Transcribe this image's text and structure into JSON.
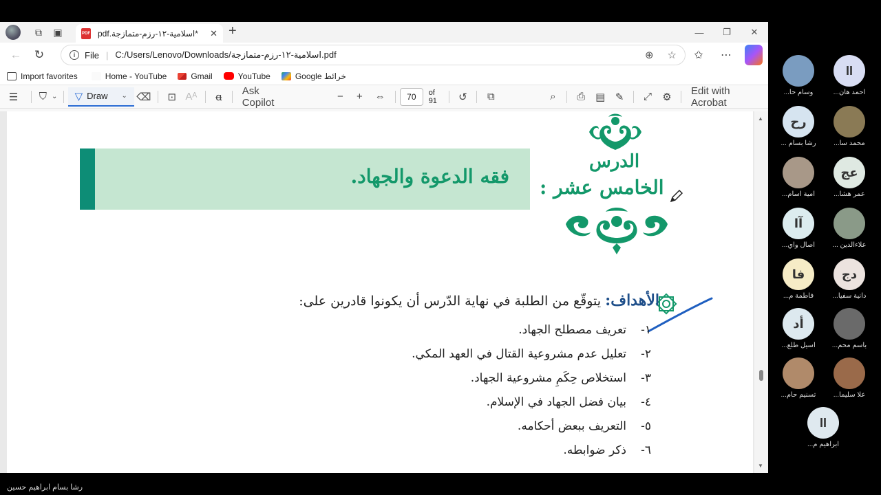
{
  "tab": {
    "title": "*اسلامية-١٢-رزم-متمازجة.pdf",
    "pdf_badge": "PDF"
  },
  "address": {
    "scheme_label": "File",
    "path": "C:/Users/Lenovo/Downloads/اسلامية-١٢-رزم-متمازجة.pdf"
  },
  "favorites": [
    {
      "label": "Import favorites"
    },
    {
      "label": "Home - YouTube"
    },
    {
      "label": "Gmail"
    },
    {
      "label": "YouTube"
    },
    {
      "label": "Google خرائط"
    }
  ],
  "pdf_toolbar": {
    "draw_label": "Draw",
    "ask_copilot": "Ask Copilot",
    "page_number": "70",
    "page_total": "of 91",
    "edit_acrobat": "Edit with Acrobat"
  },
  "document": {
    "lesson_word": "الدرس",
    "lesson_number": "الخامس عشر :",
    "banner_title": "فقه الدعوة والجهاد.",
    "goals_label": "الأهداف:",
    "goals_intro": "يتوقّع من الطلبة في نهاية الدّرس أن يكونوا قادرين على:",
    "goals": [
      {
        "num": "١-",
        "text": "تعريف مصطلح الجهاد."
      },
      {
        "num": "٢-",
        "text": "تعليل عدم مشروعية القتال في العهد المكي."
      },
      {
        "num": "٣-",
        "text": "استخلاص حِكَمِ مشروعية الجهاد."
      },
      {
        "num": "٤-",
        "text": "بيان فضل الجهاد في الإسلام."
      },
      {
        "num": "٥-",
        "text": "التعريف ببعض أحكامه."
      },
      {
        "num": "٦-",
        "text": "ذكر ضوابطه."
      }
    ]
  },
  "participants": [
    {
      "name": "وسام حا...",
      "initials": "",
      "color": "#7a9cc0"
    },
    {
      "name": "احمد هان...",
      "initials": "II",
      "color": "#d8ddf3"
    },
    {
      "name": "رشا بسام ...",
      "initials": "رح",
      "color": "#d6e4f0"
    },
    {
      "name": "محمد سا...",
      "initials": "",
      "color": "#8a7a55"
    },
    {
      "name": "امية اسام...",
      "initials": "",
      "color": "#a89888"
    },
    {
      "name": "عمر هشا...",
      "initials": "عج",
      "color": "#dfe9e2"
    },
    {
      "name": "اصال واي...",
      "initials": "آا",
      "color": "#dcecef"
    },
    {
      "name": "علاءالدين ...",
      "initials": "",
      "color": "#8a9a88"
    },
    {
      "name": "فاطمة م...",
      "initials": "فا",
      "color": "#f6ecc6"
    },
    {
      "name": "دانية سفيا...",
      "initials": "دج",
      "color": "#ece3df"
    },
    {
      "name": "اسيل طلع...",
      "initials": "أد",
      "color": "#dde9ef"
    },
    {
      "name": "باسم محم...",
      "initials": "",
      "color": "#6a6a6a"
    },
    {
      "name": "تسنيم حام...",
      "initials": "",
      "color": "#b08a6a"
    },
    {
      "name": "علا سليما...",
      "initials": "",
      "color": "#9a6a4a"
    },
    {
      "name": "ابراهيم م...",
      "initials": "II",
      "color": "#dfe9ef"
    }
  ],
  "bottom_label": "رشا بسام ابراهيم حسين",
  "colors": {
    "accent": "#2b6cd4",
    "green": "#13986a",
    "teal": "#0d8d76",
    "banner": "#c5e6d1"
  }
}
